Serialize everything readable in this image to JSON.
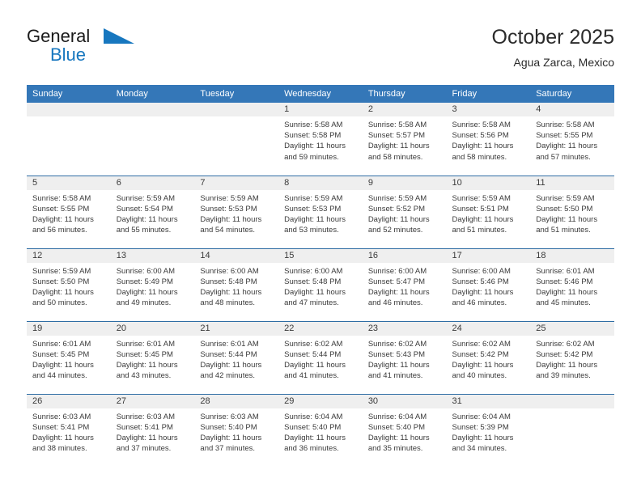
{
  "brand": {
    "name_top": "General",
    "name_bottom": "Blue",
    "triangle_icon": "triangle-icon",
    "color_dark": "#1a1a1a",
    "color_blue": "#1777bf"
  },
  "header": {
    "title": "October 2025",
    "subtitle": "Agua Zarca, Mexico"
  },
  "theme": {
    "header_bg": "#3477b8",
    "header_text": "#ffffff",
    "daynum_bg": "#efefef",
    "cell_bg": "#ffffff",
    "row_divider": "#2e6da4",
    "body_text": "#3a3a3a"
  },
  "calendar": {
    "weekday_headers": [
      "Sunday",
      "Monday",
      "Tuesday",
      "Wednesday",
      "Thursday",
      "Friday",
      "Saturday"
    ],
    "weeks": [
      [
        {
          "day": "",
          "lines": []
        },
        {
          "day": "",
          "lines": []
        },
        {
          "day": "",
          "lines": []
        },
        {
          "day": "1",
          "lines": [
            "Sunrise: 5:58 AM",
            "Sunset: 5:58 PM",
            "Daylight: 11 hours and 59 minutes."
          ]
        },
        {
          "day": "2",
          "lines": [
            "Sunrise: 5:58 AM",
            "Sunset: 5:57 PM",
            "Daylight: 11 hours and 58 minutes."
          ]
        },
        {
          "day": "3",
          "lines": [
            "Sunrise: 5:58 AM",
            "Sunset: 5:56 PM",
            "Daylight: 11 hours and 58 minutes."
          ]
        },
        {
          "day": "4",
          "lines": [
            "Sunrise: 5:58 AM",
            "Sunset: 5:55 PM",
            "Daylight: 11 hours and 57 minutes."
          ]
        }
      ],
      [
        {
          "day": "5",
          "lines": [
            "Sunrise: 5:58 AM",
            "Sunset: 5:55 PM",
            "Daylight: 11 hours and 56 minutes."
          ]
        },
        {
          "day": "6",
          "lines": [
            "Sunrise: 5:59 AM",
            "Sunset: 5:54 PM",
            "Daylight: 11 hours and 55 minutes."
          ]
        },
        {
          "day": "7",
          "lines": [
            "Sunrise: 5:59 AM",
            "Sunset: 5:53 PM",
            "Daylight: 11 hours and 54 minutes."
          ]
        },
        {
          "day": "8",
          "lines": [
            "Sunrise: 5:59 AM",
            "Sunset: 5:53 PM",
            "Daylight: 11 hours and 53 minutes."
          ]
        },
        {
          "day": "9",
          "lines": [
            "Sunrise: 5:59 AM",
            "Sunset: 5:52 PM",
            "Daylight: 11 hours and 52 minutes."
          ]
        },
        {
          "day": "10",
          "lines": [
            "Sunrise: 5:59 AM",
            "Sunset: 5:51 PM",
            "Daylight: 11 hours and 51 minutes."
          ]
        },
        {
          "day": "11",
          "lines": [
            "Sunrise: 5:59 AM",
            "Sunset: 5:50 PM",
            "Daylight: 11 hours and 51 minutes."
          ]
        }
      ],
      [
        {
          "day": "12",
          "lines": [
            "Sunrise: 5:59 AM",
            "Sunset: 5:50 PM",
            "Daylight: 11 hours and 50 minutes."
          ]
        },
        {
          "day": "13",
          "lines": [
            "Sunrise: 6:00 AM",
            "Sunset: 5:49 PM",
            "Daylight: 11 hours and 49 minutes."
          ]
        },
        {
          "day": "14",
          "lines": [
            "Sunrise: 6:00 AM",
            "Sunset: 5:48 PM",
            "Daylight: 11 hours and 48 minutes."
          ]
        },
        {
          "day": "15",
          "lines": [
            "Sunrise: 6:00 AM",
            "Sunset: 5:48 PM",
            "Daylight: 11 hours and 47 minutes."
          ]
        },
        {
          "day": "16",
          "lines": [
            "Sunrise: 6:00 AM",
            "Sunset: 5:47 PM",
            "Daylight: 11 hours and 46 minutes."
          ]
        },
        {
          "day": "17",
          "lines": [
            "Sunrise: 6:00 AM",
            "Sunset: 5:46 PM",
            "Daylight: 11 hours and 46 minutes."
          ]
        },
        {
          "day": "18",
          "lines": [
            "Sunrise: 6:01 AM",
            "Sunset: 5:46 PM",
            "Daylight: 11 hours and 45 minutes."
          ]
        }
      ],
      [
        {
          "day": "19",
          "lines": [
            "Sunrise: 6:01 AM",
            "Sunset: 5:45 PM",
            "Daylight: 11 hours and 44 minutes."
          ]
        },
        {
          "day": "20",
          "lines": [
            "Sunrise: 6:01 AM",
            "Sunset: 5:45 PM",
            "Daylight: 11 hours and 43 minutes."
          ]
        },
        {
          "day": "21",
          "lines": [
            "Sunrise: 6:01 AM",
            "Sunset: 5:44 PM",
            "Daylight: 11 hours and 42 minutes."
          ]
        },
        {
          "day": "22",
          "lines": [
            "Sunrise: 6:02 AM",
            "Sunset: 5:44 PM",
            "Daylight: 11 hours and 41 minutes."
          ]
        },
        {
          "day": "23",
          "lines": [
            "Sunrise: 6:02 AM",
            "Sunset: 5:43 PM",
            "Daylight: 11 hours and 41 minutes."
          ]
        },
        {
          "day": "24",
          "lines": [
            "Sunrise: 6:02 AM",
            "Sunset: 5:42 PM",
            "Daylight: 11 hours and 40 minutes."
          ]
        },
        {
          "day": "25",
          "lines": [
            "Sunrise: 6:02 AM",
            "Sunset: 5:42 PM",
            "Daylight: 11 hours and 39 minutes."
          ]
        }
      ],
      [
        {
          "day": "26",
          "lines": [
            "Sunrise: 6:03 AM",
            "Sunset: 5:41 PM",
            "Daylight: 11 hours and 38 minutes."
          ]
        },
        {
          "day": "27",
          "lines": [
            "Sunrise: 6:03 AM",
            "Sunset: 5:41 PM",
            "Daylight: 11 hours and 37 minutes."
          ]
        },
        {
          "day": "28",
          "lines": [
            "Sunrise: 6:03 AM",
            "Sunset: 5:40 PM",
            "Daylight: 11 hours and 37 minutes."
          ]
        },
        {
          "day": "29",
          "lines": [
            "Sunrise: 6:04 AM",
            "Sunset: 5:40 PM",
            "Daylight: 11 hours and 36 minutes."
          ]
        },
        {
          "day": "30",
          "lines": [
            "Sunrise: 6:04 AM",
            "Sunset: 5:40 PM",
            "Daylight: 11 hours and 35 minutes."
          ]
        },
        {
          "day": "31",
          "lines": [
            "Sunrise: 6:04 AM",
            "Sunset: 5:39 PM",
            "Daylight: 11 hours and 34 minutes."
          ]
        },
        {
          "day": "",
          "lines": []
        }
      ]
    ]
  }
}
